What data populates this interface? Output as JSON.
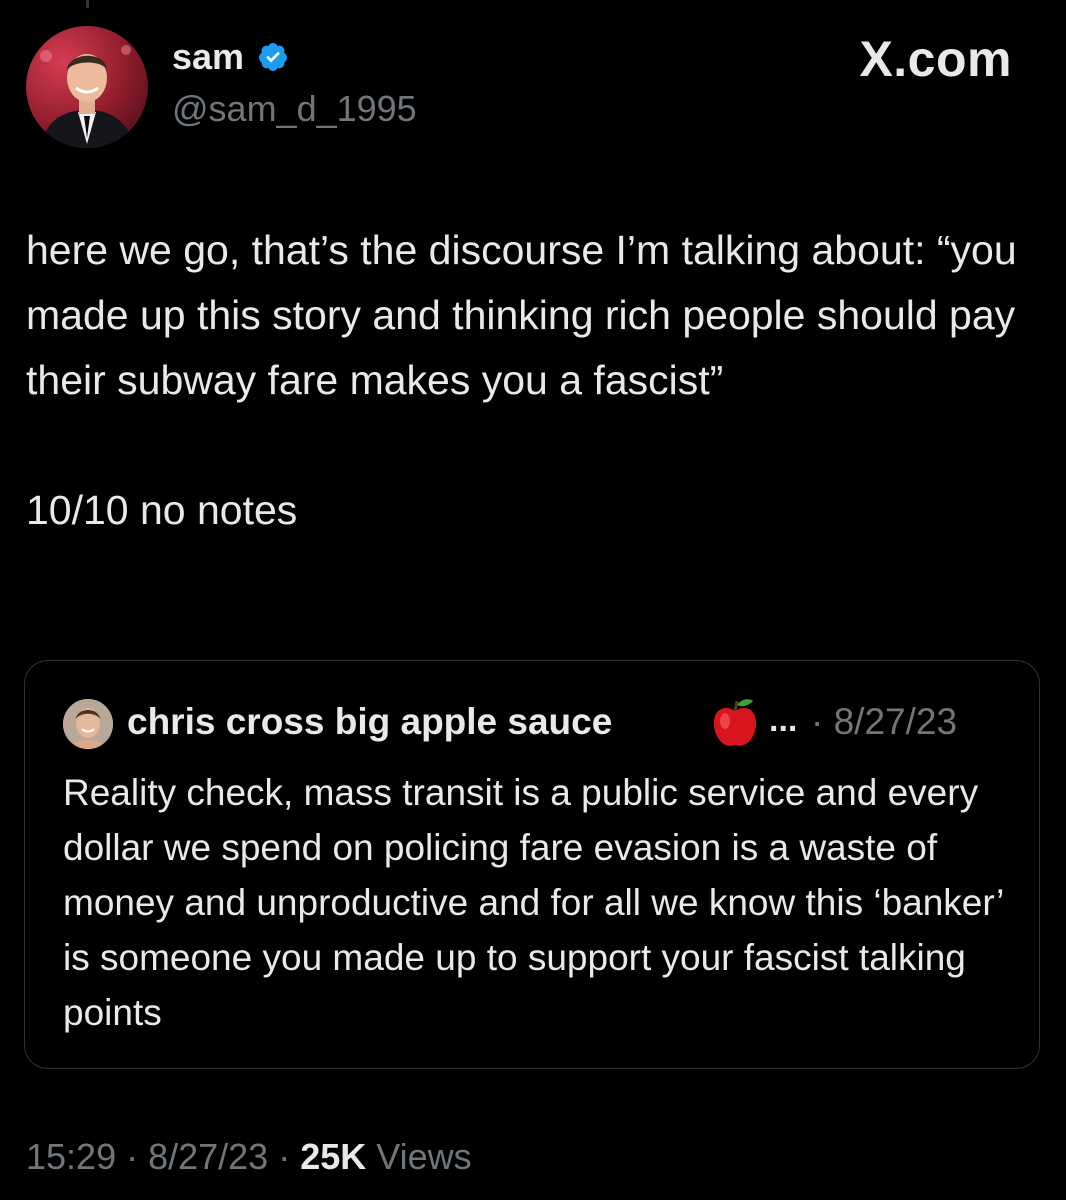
{
  "author": {
    "display_name": "sam",
    "handle": "@sam_d_1995",
    "verified_icon": "verified-badge-icon",
    "accent": "#1d9bf0"
  },
  "brand": "X.com",
  "tweet": {
    "text": "here we go, that’s the discourse I’m talking about: “you made up this story and thinking rich people should pay their subway fare makes you a fascist”\n\n10/10 no notes"
  },
  "quote": {
    "display_name": "chris cross big apple sauce",
    "emoji_icon": "red-apple-icon",
    "ellipsis": "...",
    "meta": "· 8/27/23",
    "text": "Reality check, mass transit is a public service and every dollar we spend on policing fare evasion is a waste of money and unproductive and for all we know this ‘banker’ is someone you made up to support your fascist talking points"
  },
  "footer": {
    "time_date": "15:29 · 8/27/23 · ",
    "views_count": "25K",
    "views_label": " Views"
  }
}
